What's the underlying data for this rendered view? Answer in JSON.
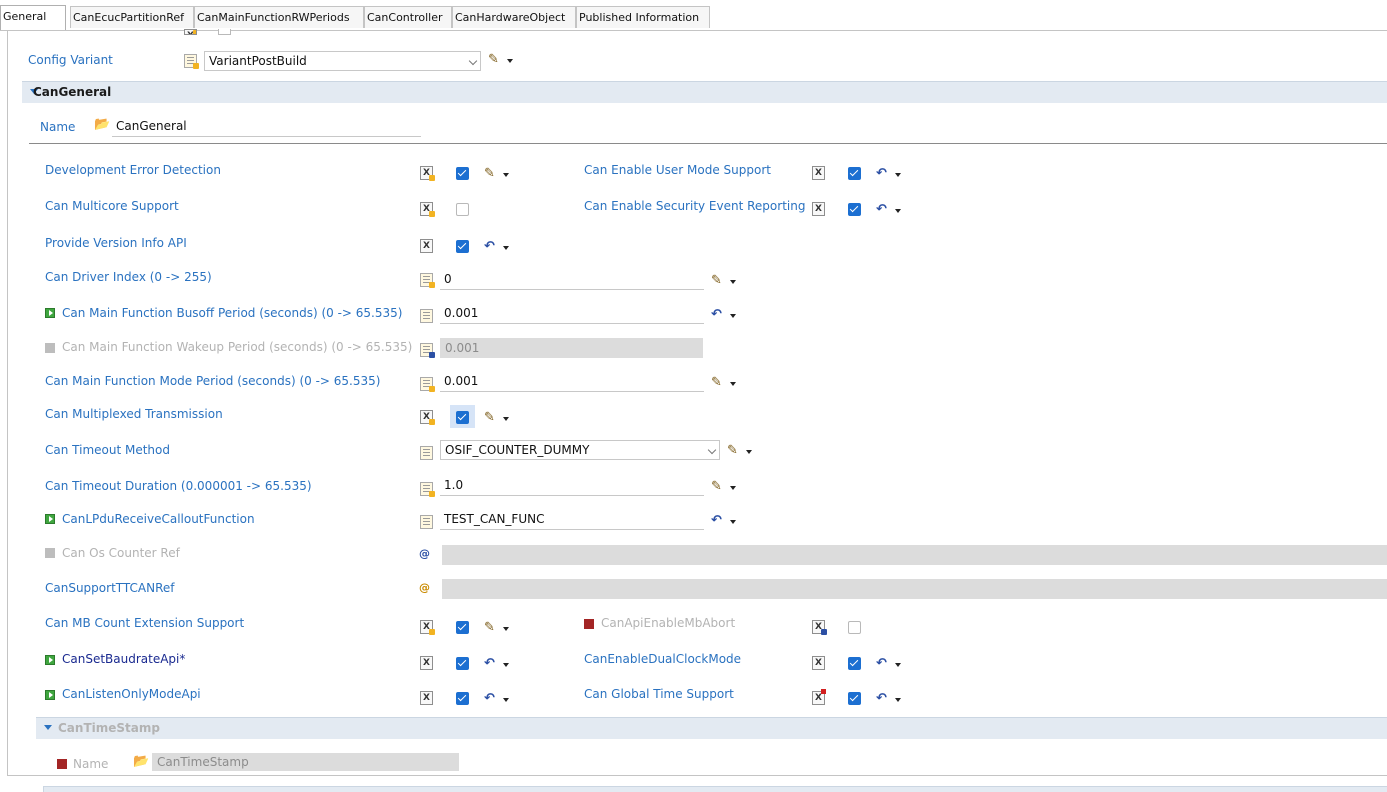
{
  "tabs": [
    "General",
    "CanEcucPartitionRef",
    "CanMainFunctionRWPeriods",
    "CanController",
    "CanHardwareObject",
    "Published Information"
  ],
  "config_variant": {
    "label": "Config Variant",
    "value": "VariantPostBuild"
  },
  "can_general": {
    "title": "CanGeneral",
    "name_label": "Name",
    "name_value": "CanGeneral",
    "left_params": [
      {
        "label": "Development Error Detection",
        "checked": true
      },
      {
        "label": "Can Multicore Support",
        "checked": false
      },
      {
        "label": "Provide Version Info API",
        "checked": true
      },
      {
        "label": "Can Driver Index (0 -> 255)",
        "value": "0"
      },
      {
        "label": "Can Main Function Busoff Period (seconds) (0 -> 65.535)",
        "value": "0.001"
      },
      {
        "label": "Can Main Function Wakeup Period (seconds) (0 -> 65.535)",
        "value": "0.001"
      },
      {
        "label": "Can Main Function Mode Period (seconds) (0 -> 65.535)",
        "value": "0.001"
      },
      {
        "label": "Can Multiplexed Transmission",
        "checked": true
      },
      {
        "label": "Can Timeout Method",
        "value": "OSIF_COUNTER_DUMMY"
      },
      {
        "label": "Can Timeout Duration (0.000001 -> 65.535)",
        "value": "1.0"
      },
      {
        "label": "CanLPduReceiveCalloutFunction",
        "value": "TEST_CAN_FUNC"
      },
      {
        "label": "Can Os Counter Ref",
        "value": ""
      },
      {
        "label": "CanSupportTTCANRef",
        "value": ""
      },
      {
        "label": "Can MB Count Extension Support",
        "checked": true
      },
      {
        "label": "CanSetBaudrateApi*",
        "checked": true
      },
      {
        "label": "CanListenOnlyModeApi",
        "checked": true
      }
    ],
    "right_params": [
      {
        "label": "Can Enable User Mode Support",
        "checked": true
      },
      {
        "label": "Can Enable Security Event Reporting",
        "checked": true
      },
      {
        "label": "CanApiEnableMbAbort",
        "checked": false
      },
      {
        "label": "CanEnableDualClockMode",
        "checked": true
      },
      {
        "label": "Can Global Time Support",
        "checked": true
      }
    ]
  },
  "can_timestamp": {
    "title": "CanTimeStamp",
    "name_label": "Name",
    "name_value": "CanTimeStamp"
  },
  "icons": {
    "edit": "pencil-icon",
    "revert": "undo-arrow-icon",
    "folder": "folder-icon",
    "enabled_flag": "green-play-flag-icon",
    "disabled_flag": "grey-square-flag-icon"
  },
  "colors": {
    "label": "#2a72c0",
    "section_bg": "#e3eaf2",
    "checkbox_on": "#1c6fd1",
    "disabled_field": "#dcdcdc"
  }
}
